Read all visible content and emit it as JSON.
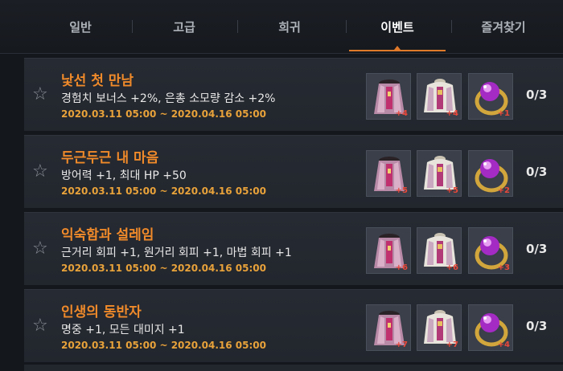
{
  "tabs": [
    {
      "label": "일반",
      "active": false
    },
    {
      "label": "고급",
      "active": false
    },
    {
      "label": "희귀",
      "active": false
    },
    {
      "label": "이벤트",
      "active": true
    },
    {
      "label": "즐겨찾기",
      "active": false
    }
  ],
  "colors": {
    "accent": "#e07a2a",
    "title": "#f08a2a",
    "date": "#e8a23a",
    "enhance": "#e8483a"
  },
  "icons": {
    "favorite": "star-outline-icon",
    "item1": "dark-cloak-icon",
    "item2": "white-cloak-icon",
    "item3": "purple-gem-ring-icon"
  },
  "collections": [
    {
      "title": "낯선 첫 만남",
      "desc": "경험치 보너스 +2%, 은총 소모량 감소 +2%",
      "date": "2020.03.11 05:00 ~ 2020.04.16 05:00",
      "items": [
        "+4",
        "+4",
        "+1"
      ],
      "count": "0/3"
    },
    {
      "title": "두근두근 내 마음",
      "desc": "방어력 +1, 최대 HP +50",
      "date": "2020.03.11 05:00 ~ 2020.04.16 05:00",
      "items": [
        "+5",
        "+5",
        "+2"
      ],
      "count": "0/3"
    },
    {
      "title": "익숙함과 설레임",
      "desc": "근거리 회피 +1, 원거리 회피 +1, 마법 회피 +1",
      "date": "2020.03.11 05:00 ~ 2020.04.16 05:00",
      "items": [
        "+6",
        "+6",
        "+3"
      ],
      "count": "0/3"
    },
    {
      "title": "인생의 동반자",
      "desc": "명중 +1, 모든 대미지 +1",
      "date": "2020.03.11 05:00 ~ 2020.04.16 05:00",
      "items": [
        "+7",
        "+7",
        "+4"
      ],
      "count": "0/3"
    }
  ]
}
